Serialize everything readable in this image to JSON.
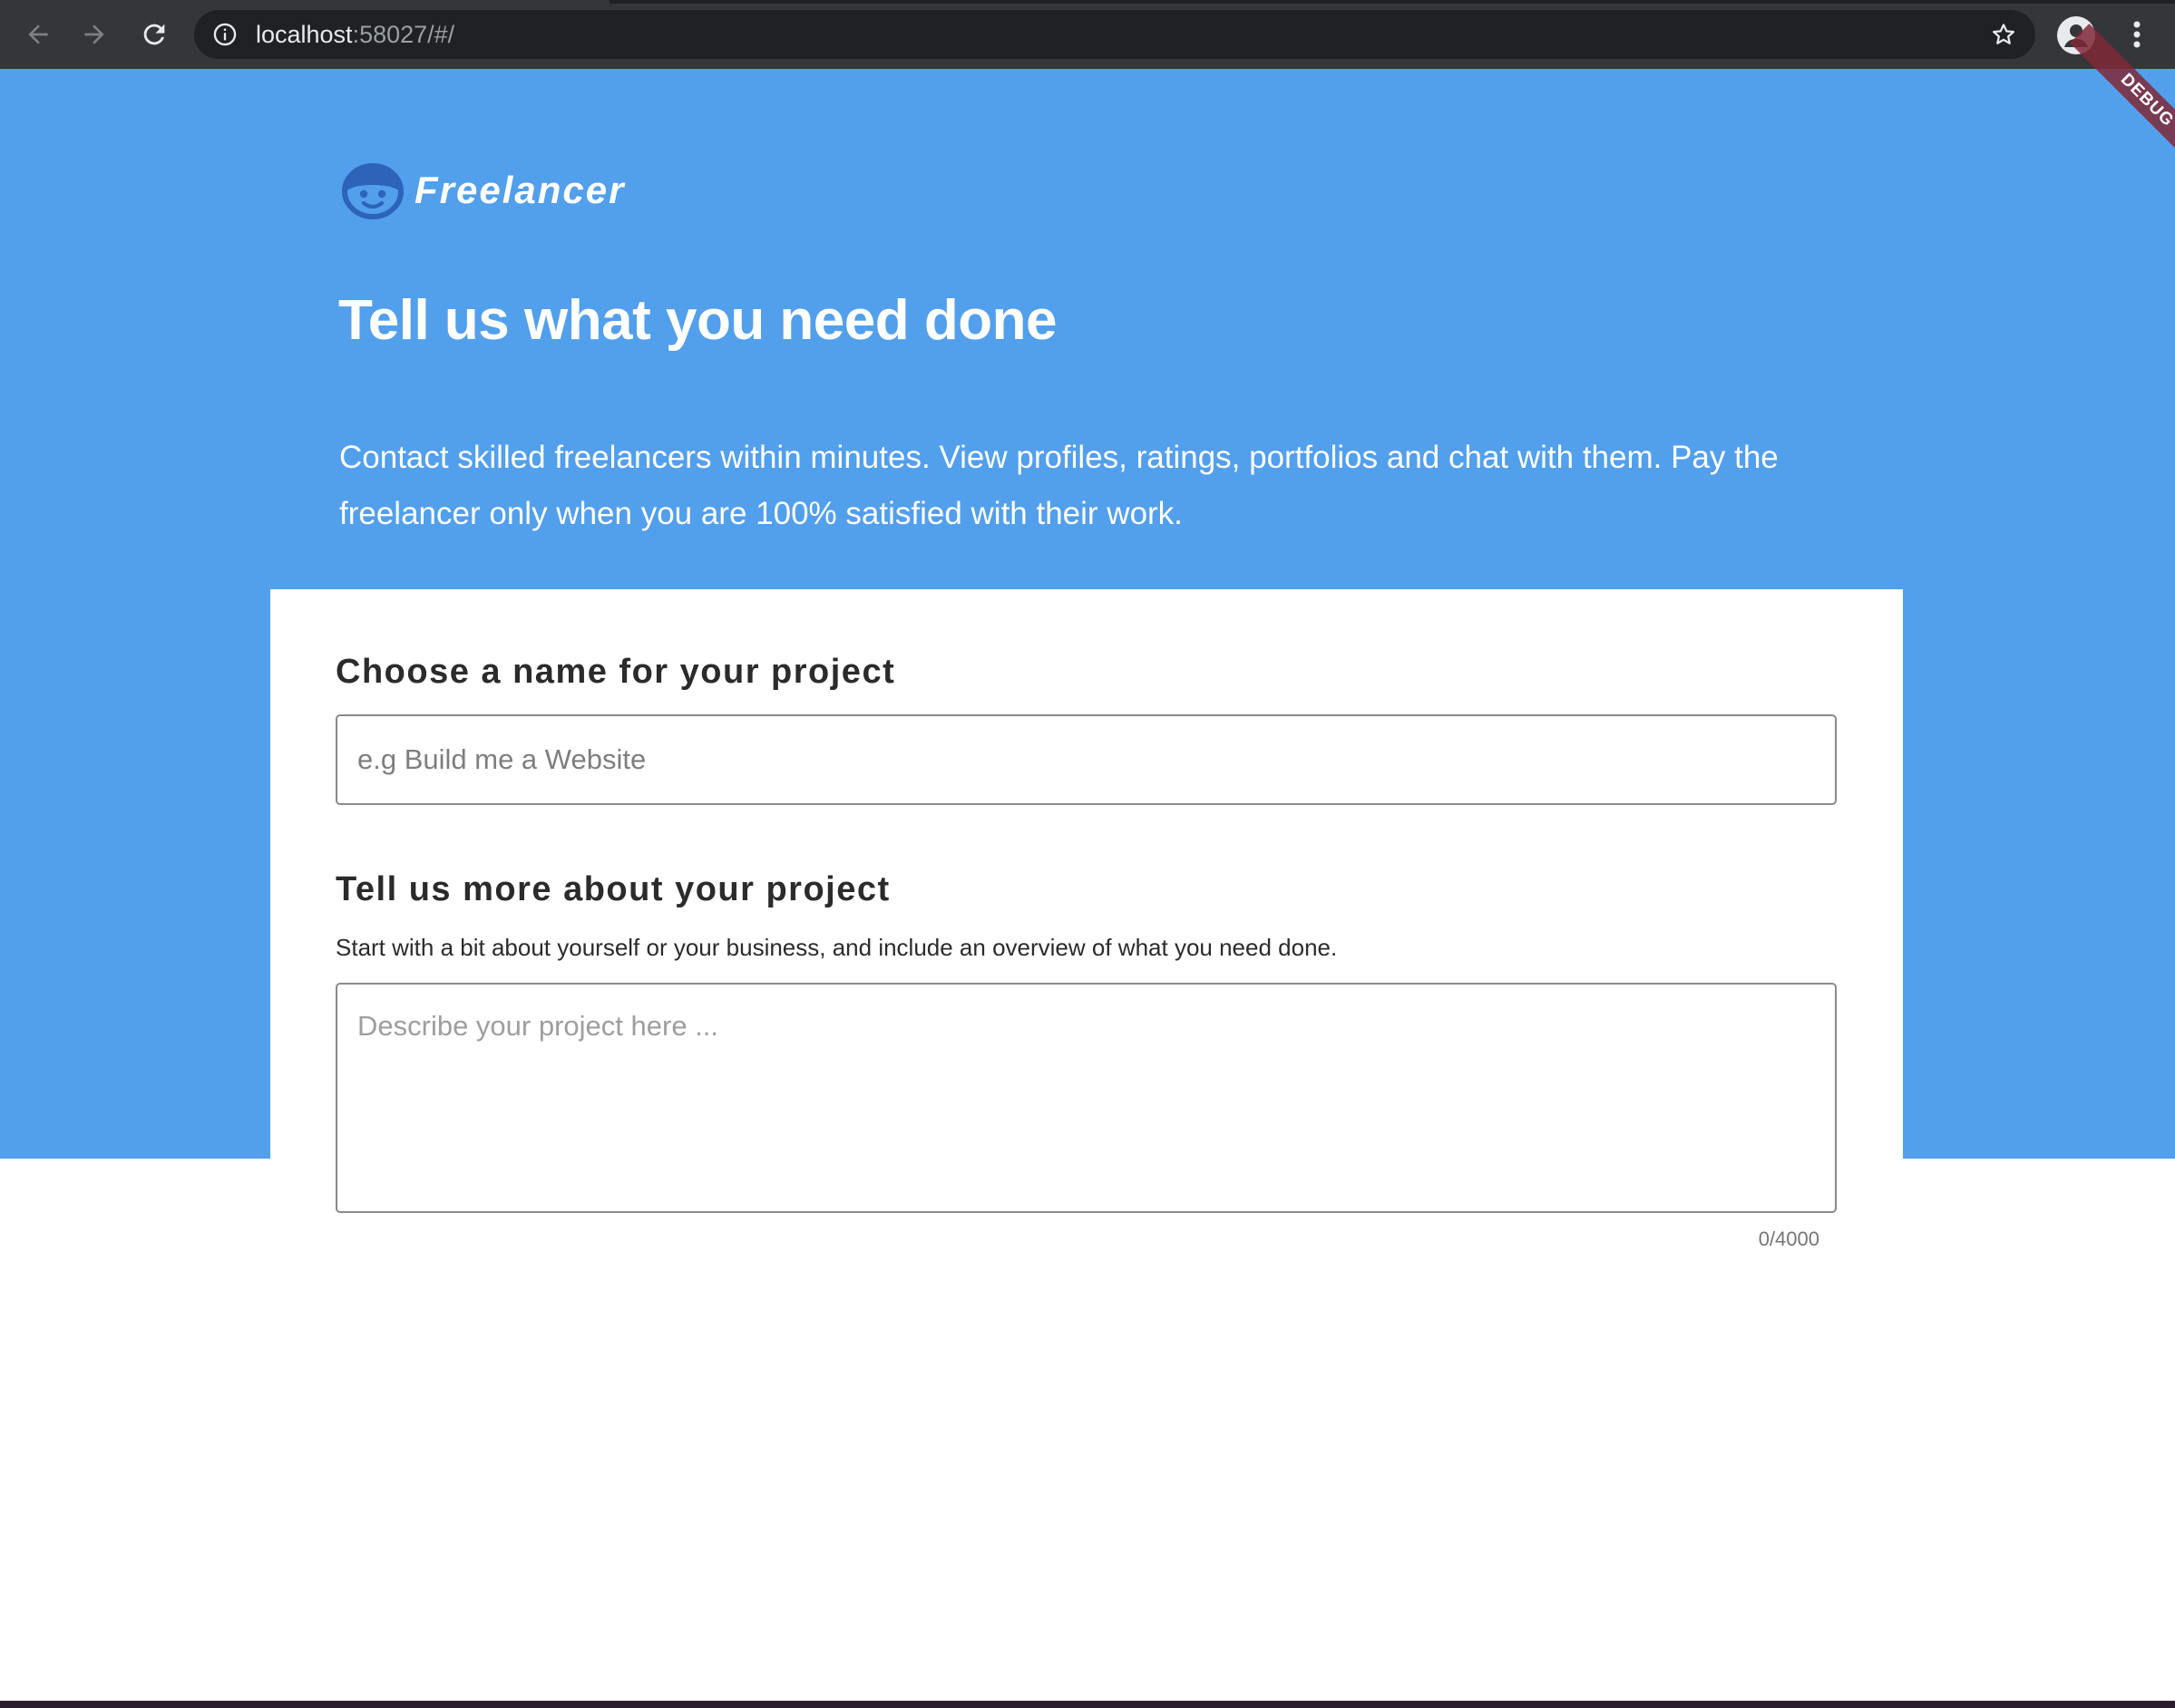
{
  "browser": {
    "url_host": "localhost",
    "url_rest": ":58027/#/"
  },
  "brand": {
    "name": "Freelancer"
  },
  "hero": {
    "headline": "Tell us what you need done",
    "description": "Contact skilled freelancers within minutes. View profiles, ratings, portfolios and chat with them. Pay the freelancer only when you are 100% satisfied with their work."
  },
  "form": {
    "name_field": {
      "label": "Choose a name for your project",
      "placeholder": "e.g Build me a Website",
      "value": ""
    },
    "description_field": {
      "label": "Tell us more about your project",
      "help": "Start with a bit about yourself or your business, and include an overview of what you need done.",
      "placeholder": "Describe your project here ...",
      "value": "",
      "counter": "0/4000"
    }
  },
  "debug_banner": "DEBUG",
  "colors": {
    "hero_background": "#529fec",
    "logo_icon": "#2d63b8",
    "chrome_background": "#35363a"
  }
}
